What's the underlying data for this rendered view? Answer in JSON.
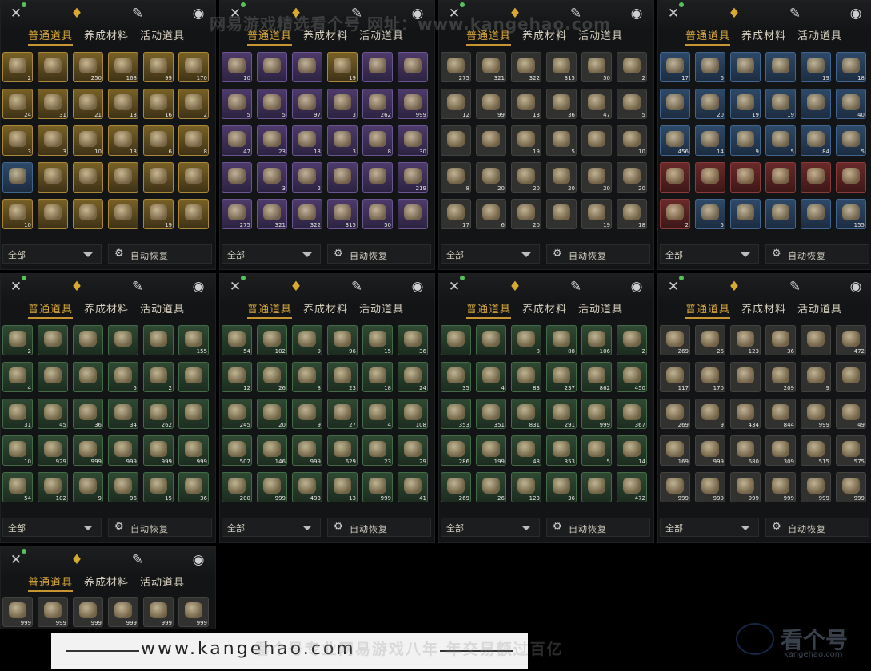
{
  "tabs": {
    "sub": [
      "普通道具",
      "养成材料",
      "活动道具"
    ]
  },
  "icons": [
    "battle-icon",
    "pouch-icon",
    "scroll-icon",
    "token-icon"
  ],
  "footer": {
    "filter_value": "全部",
    "auto_restore_label": "自动恢复",
    "gear_glyph": "⚙"
  },
  "watermarks": {
    "top": "网易游戏精选看个号 网址：www.kangehao.com",
    "url": "www.kangehao.com",
    "slogan": "看个号专业网易游戏八年 年交易额过百亿",
    "logo_brand": "看个号",
    "logo_domain": "kangehao.com"
  },
  "panels": [
    {
      "rows": [
        [
          "2",
          "",
          "250",
          "168",
          "99",
          "170"
        ],
        [
          "24",
          "31",
          "21",
          "13",
          "16",
          "2"
        ],
        [
          "3",
          "3",
          "10",
          "13",
          "6",
          "8"
        ],
        [
          "",
          "",
          "",
          "",
          "",
          ""
        ],
        [
          "10",
          "",
          "",
          "",
          "19",
          ""
        ]
      ],
      "tint": [
        "gold",
        "gold",
        "gold",
        "gold",
        "gold",
        "gold",
        "gold",
        "gold",
        "gold",
        "gold",
        "gold",
        "gold",
        "gold",
        "gold",
        "gold",
        "gold",
        "gold",
        "gold",
        "blue",
        "gold",
        "gold",
        "gold",
        "gold",
        "gold",
        "gold",
        "gold",
        "gold",
        "gold",
        "gold",
        "gold"
      ]
    },
    {
      "rows": [
        [
          "10",
          "",
          "",
          "19",
          "",
          ""
        ],
        [
          "5",
          "5",
          "97",
          "3",
          "262",
          "999"
        ],
        [
          "47",
          "23",
          "13",
          "3",
          "8",
          "30"
        ],
        [
          "",
          "3",
          "2",
          "",
          "",
          "219"
        ],
        [
          "275",
          "321",
          "322",
          "315",
          "50",
          ""
        ]
      ],
      "tint": [
        "purple",
        "purple",
        "purple",
        "gold",
        "purple",
        "purple",
        "purple",
        "purple",
        "purple",
        "purple",
        "purple",
        "purple",
        "purple",
        "purple",
        "purple",
        "purple",
        "purple",
        "purple",
        "purple",
        "purple",
        "purple",
        "purple",
        "purple",
        "purple",
        "purple",
        "purple",
        "purple",
        "purple",
        "purple",
        "purple"
      ]
    },
    {
      "rows": [
        [
          "275",
          "321",
          "322",
          "315",
          "50",
          "2"
        ],
        [
          "12",
          "99",
          "13",
          "36",
          "47",
          "5"
        ],
        [
          "",
          "",
          "19",
          "5",
          "",
          "10"
        ],
        [
          "8",
          "20",
          "20",
          "20",
          "20",
          "20"
        ],
        [
          "17",
          "6",
          "20",
          "",
          "19",
          "18"
        ]
      ],
      "tint": [
        "gray",
        "gray",
        "gray",
        "gray",
        "gray",
        "gray",
        "gray",
        "gray",
        "gray",
        "gray",
        "gray",
        "gray",
        "gray",
        "gray",
        "gray",
        "gray",
        "gray",
        "gray",
        "gray",
        "gray",
        "gray",
        "gray",
        "gray",
        "gray",
        "gray",
        "gray",
        "gray",
        "gray",
        "gray",
        "gray"
      ]
    },
    {
      "rows": [
        [
          "17",
          "6",
          "",
          "",
          "19",
          "18"
        ],
        [
          "",
          "20",
          "19",
          "19",
          "",
          "40"
        ],
        [
          "456",
          "14",
          "9",
          "5",
          "84",
          "5"
        ],
        [
          "",
          "",
          "",
          "",
          "",
          ""
        ],
        [
          "2",
          "5",
          "",
          "",
          "",
          "155"
        ]
      ],
      "tint": [
        "blue",
        "blue",
        "blue",
        "blue",
        "blue",
        "blue",
        "blue",
        "blue",
        "blue",
        "blue",
        "blue",
        "blue",
        "blue",
        "blue",
        "blue",
        "blue",
        "blue",
        "blue",
        "red",
        "red",
        "red",
        "red",
        "red",
        "red",
        "red",
        "blue",
        "blue",
        "blue",
        "blue",
        "blue"
      ]
    },
    {
      "rows": [
        [
          "2",
          "",
          "",
          "",
          "",
          "155"
        ],
        [
          "4",
          "",
          "",
          "5",
          "2",
          ""
        ],
        [
          "31",
          "45",
          "36",
          "34",
          "262",
          ""
        ],
        [
          "10",
          "929",
          "999",
          "999",
          "999",
          "999"
        ],
        [
          "54",
          "102",
          "9",
          "96",
          "15",
          "36"
        ]
      ],
      "tint": [
        "green",
        "green",
        "green",
        "green",
        "green",
        "green",
        "green",
        "green",
        "green",
        "green",
        "green",
        "green",
        "green",
        "green",
        "green",
        "green",
        "green",
        "green",
        "green",
        "green",
        "green",
        "green",
        "green",
        "green",
        "green",
        "green",
        "green",
        "green",
        "green",
        "green"
      ]
    },
    {
      "rows": [
        [
          "54",
          "102",
          "9",
          "96",
          "15",
          "36"
        ],
        [
          "12",
          "26",
          "8",
          "23",
          "18",
          "24"
        ],
        [
          "245",
          "20",
          "9",
          "27",
          "4",
          "108"
        ],
        [
          "507",
          "146",
          "999",
          "629",
          "23",
          "29"
        ],
        [
          "200",
          "999",
          "493",
          "13",
          "999",
          "41"
        ]
      ],
      "tint": [
        "green",
        "green",
        "green",
        "green",
        "green",
        "green",
        "green",
        "green",
        "green",
        "green",
        "green",
        "green",
        "green",
        "green",
        "green",
        "green",
        "green",
        "green",
        "green",
        "green",
        "green",
        "green",
        "green",
        "green",
        "green",
        "green",
        "green",
        "green",
        "green",
        "green"
      ]
    },
    {
      "rows": [
        [
          "",
          "",
          "8",
          "88",
          "106",
          "2"
        ],
        [
          "35",
          "4",
          "83",
          "237",
          "862",
          "450"
        ],
        [
          "353",
          "351",
          "831",
          "291",
          "999",
          "367"
        ],
        [
          "286",
          "199",
          "48",
          "353",
          "5",
          "14"
        ],
        [
          "269",
          "26",
          "123",
          "36",
          "",
          "472"
        ]
      ],
      "tint": [
        "green",
        "green",
        "green",
        "green",
        "green",
        "green",
        "green",
        "green",
        "green",
        "green",
        "green",
        "green",
        "green",
        "green",
        "green",
        "green",
        "green",
        "green",
        "green",
        "green",
        "green",
        "green",
        "green",
        "green",
        "green",
        "green",
        "green",
        "green",
        "green",
        "green"
      ]
    },
    {
      "rows": [
        [
          "269",
          "26",
          "123",
          "36",
          "",
          "472"
        ],
        [
          "117",
          "170",
          "",
          "209",
          "9",
          ""
        ],
        [
          "269",
          "9",
          "434",
          "844",
          "999",
          "49"
        ],
        [
          "169",
          "999",
          "680",
          "309",
          "515",
          "575"
        ],
        [
          "999",
          "999",
          "999",
          "999",
          "999",
          "999"
        ]
      ],
      "tint": [
        "gray",
        "gray",
        "gray",
        "gray",
        "gray",
        "gray",
        "gray",
        "gray",
        "gray",
        "gray",
        "gray",
        "gray",
        "gray",
        "gray",
        "gray",
        "gray",
        "gray",
        "gray",
        "gray",
        "gray",
        "gray",
        "gray",
        "gray",
        "gray",
        "gray",
        "gray",
        "gray",
        "gray",
        "gray",
        "gray"
      ]
    },
    {
      "rows": [
        [
          "999",
          "999",
          "999",
          "999",
          "999",
          "999"
        ]
      ],
      "tint": [
        "gray",
        "gray",
        "gray",
        "gray",
        "gray",
        "gray"
      ]
    }
  ]
}
